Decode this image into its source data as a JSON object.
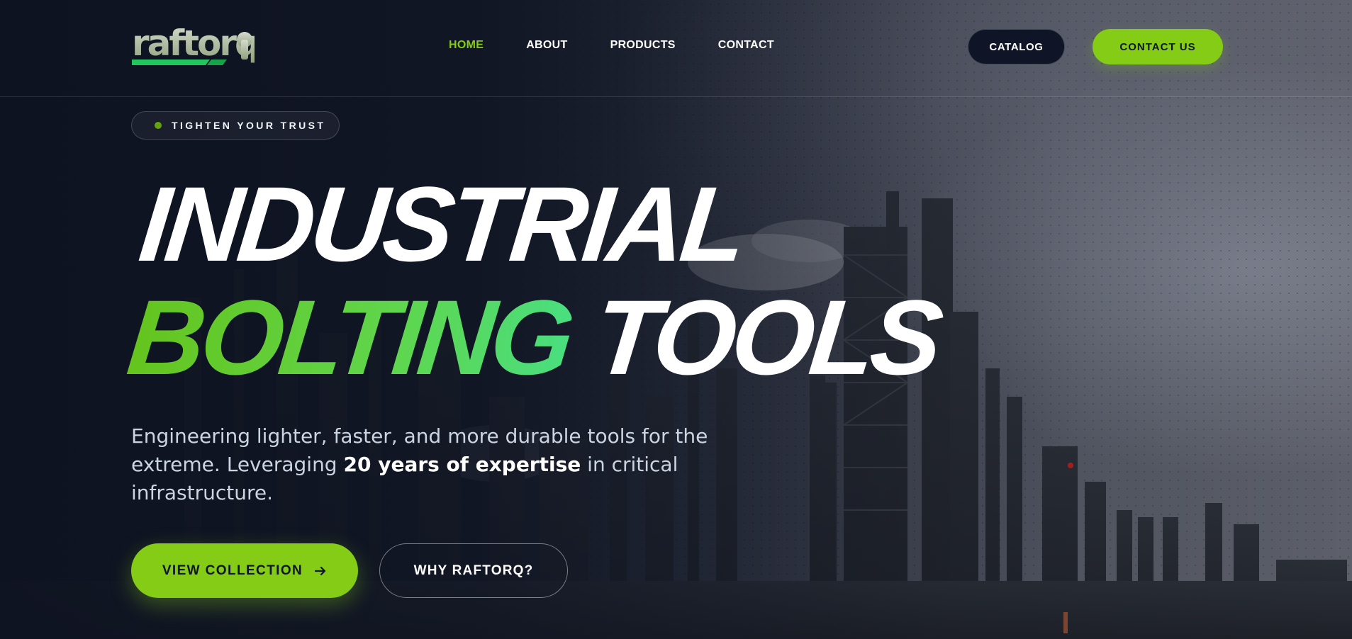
{
  "brand": {
    "name": "raftorq",
    "accent": "#84cc16",
    "accent_gradient_end": "#4ade80",
    "bg": "#141a2c"
  },
  "nav": {
    "items": [
      {
        "label": "HOME",
        "active": true
      },
      {
        "label": "ABOUT",
        "active": false
      },
      {
        "label": "PRODUCTS",
        "active": false
      },
      {
        "label": "CONTACT",
        "active": false
      }
    ]
  },
  "header": {
    "catalog_label": "CATALOG",
    "contact_label": "CONTACT US"
  },
  "hero": {
    "badge": "TIGHTEN YOUR TRUST",
    "headline_line1": "INDUSTRIAL",
    "headline_accent": "BOLTING",
    "headline_rest": "TOOLS",
    "lead_part1": "Engineering lighter, faster, and more durable tools for the extreme. Leveraging ",
    "lead_strong": "20 years of expertise",
    "lead_part2": " in critical infrastructure.",
    "primary_cta": "VIEW COLLECTION",
    "secondary_cta": "WHY RAFTORQ?",
    "background_image": "industrial refinery skyline"
  }
}
